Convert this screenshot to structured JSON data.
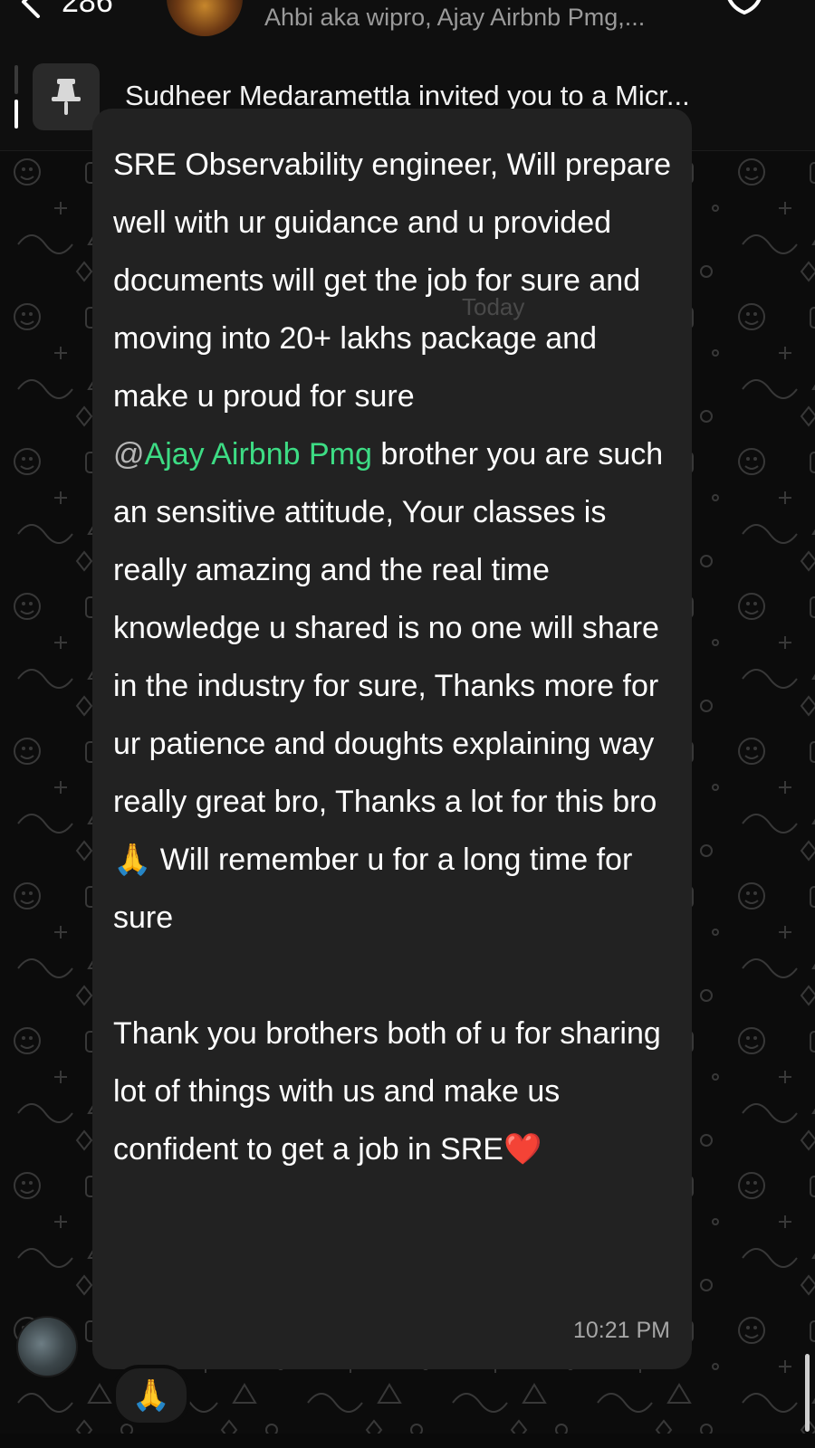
{
  "header": {
    "back_count": "286",
    "members": "Ahbi aka wipro, Ajay Airbnb Pmg,..."
  },
  "pinned": {
    "text": "Sudheer Medaramettla invited you to a Micr..."
  },
  "message": {
    "date_separator": "Today",
    "paragraph1": "SRE Observability engineer, Will prepare well with ur guidance and u provided documents will get the job for sure and moving into 20+ lakhs package and make u proud for sure",
    "mention_at": "@",
    "mention_name": "Ajay Airbnb Pmg",
    "paragraph2_rest": " brother you are such an sensitive attitude, Your classes is really amazing and the real time knowledge u shared is no one will share in the industry for sure, Thanks more for ur patience and doughts explaining way really great bro, Thanks a lot for this bro 🙏 Will remember u for a long time for sure",
    "paragraph3": "Thank you brothers both of u for sharing lot of things with us and make us confident to get a job in SRE❤️",
    "time": "10:21 PM"
  },
  "reaction": {
    "emoji": "🙏"
  },
  "colors": {
    "mention": "#3ddc84",
    "bubble": "#222222",
    "background": "#0c0c0c"
  },
  "icons": {
    "back": "chevron-left-icon",
    "pin": "pin-icon",
    "call": "call-add-icon"
  }
}
